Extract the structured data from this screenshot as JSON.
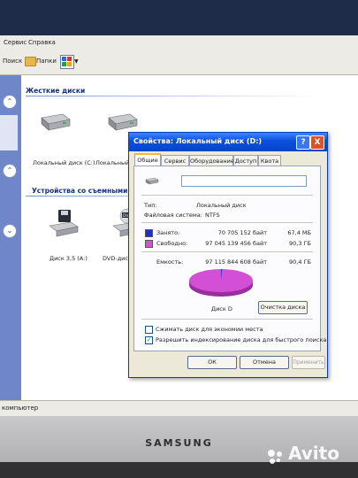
{
  "menu": {
    "service": "Сервис",
    "help": "Справка"
  },
  "toolbar": {
    "search": "Поиск",
    "folders": "Папки"
  },
  "groups": {
    "hard_disks": "Жесткие диски",
    "removable": "Устройства со съемными носителя"
  },
  "drives": {
    "c": "Локальный диск (C:)",
    "d": "Локальный дис",
    "floppy": "Диск 3,5 (A:)",
    "dvd": "DVD-дисковод"
  },
  "dialog": {
    "title": "Свойства: Локальный диск (D:)",
    "tabs": [
      "Общие",
      "Сервис",
      "Оборудование",
      "Доступ",
      "Квота"
    ],
    "type_label": "Тип:",
    "type_value": "Локальный диск",
    "fs_label": "Файловая система:",
    "fs_value": "NTFS",
    "used_label": "Занято:",
    "used_bytes": "70 705 152 байт",
    "used_size": "67,4 МБ",
    "free_label": "Свободно:",
    "free_bytes": "97 045 139 456 байт",
    "free_size": "90,3 ГБ",
    "capacity_label": "Емкость:",
    "capacity_bytes": "97 115 844 608 байт",
    "capacity_size": "90,4 ГБ",
    "pie_label": "Диск D",
    "cleanup_button": "Очистка диска",
    "compress_label": "Сжимать диск для экономии места",
    "compress_checked": false,
    "index_label": "Разрешить индексирование диска для быстрого поиска",
    "index_checked": true,
    "ok": "ОК",
    "cancel": "Отмена",
    "apply": "Применить",
    "help_symbol": "?",
    "close_symbol": "X"
  },
  "usage": {
    "used_fraction": 0.0007,
    "used_color": "#1a2fd6",
    "free_color": "#d24fd6"
  },
  "statusbar": {
    "text": "компьютер"
  },
  "bezel": {
    "brand": "SAMSUNG"
  },
  "watermark": "Avito"
}
